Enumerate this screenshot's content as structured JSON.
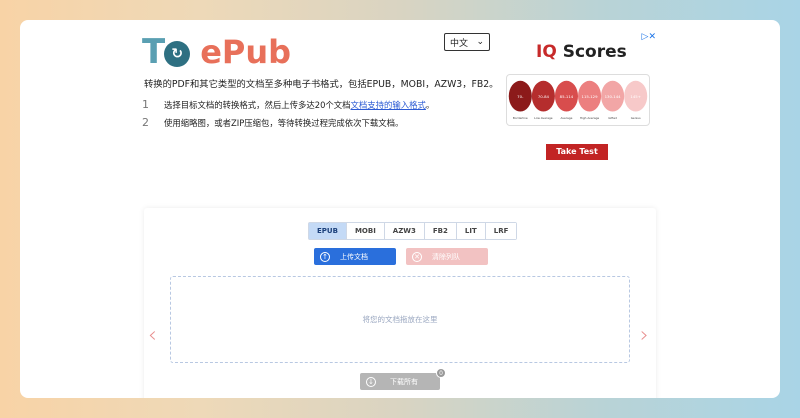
{
  "logo": {
    "t": "T",
    "o": "o",
    "ep": "ePub"
  },
  "lang": {
    "selected": "中文"
  },
  "intro": "转换的PDF和其它类型的文档至多种电子书格式，包括EPUB，MOBI，AZW3，FB2。",
  "steps": [
    {
      "num": "1",
      "text_before": "选择目标文档的转换格式，然后上传多达20个文档",
      "link": "文档支持的输入格式",
      "text_after": "。"
    },
    {
      "num": "2",
      "text": "使用缩略图，或者ZIP压缩包，等待转换过程完成依次下载文档。"
    }
  ],
  "ad": {
    "title_prefix": "IQ",
    "title_suffix": " Scores",
    "close": "▷✕",
    "cta": "Take Test",
    "heads": [
      {
        "range": "70-",
        "label": "Borderline",
        "color": "#8c1a1a"
      },
      {
        "range": "70-84",
        "label": "Low Average",
        "color": "#b52d2d"
      },
      {
        "range": "85-114",
        "label": "Average",
        "color": "#d84d4d"
      },
      {
        "range": "115-129",
        "label": "High Average",
        "color": "#ec7f7f"
      },
      {
        "range": "130-144",
        "label": "Gifted",
        "color": "#f2a6a6"
      },
      {
        "range": "145+",
        "label": "Genius",
        "color": "#f7c9c9"
      }
    ]
  },
  "converter": {
    "formats": [
      "EPUB",
      "MOBI",
      "AZW3",
      "FB2",
      "LIT",
      "LRF"
    ],
    "active_format": "EPUB",
    "upload_label": "上传文档",
    "clear_label": "清除列队",
    "drop_text": "将您的文档拖放在这里",
    "download_label": "下载所有",
    "download_count": "0",
    "prev_arrow": "‹",
    "next_arrow": "›"
  },
  "colors": {
    "accent_blue": "#2a6fdc",
    "logo_teal": "#5a9fb2",
    "logo_orange": "#e8705a",
    "cta_red": "#c22424"
  }
}
